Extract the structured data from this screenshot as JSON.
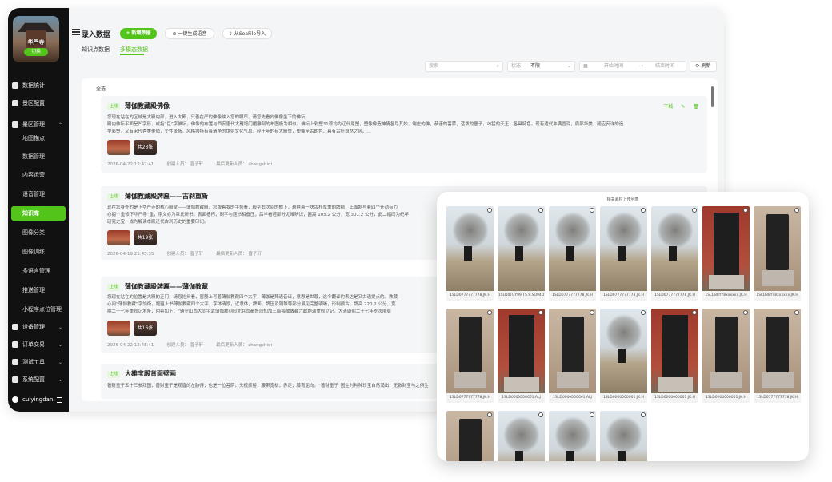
{
  "sidebar": {
    "profile": {
      "name": "华严寺",
      "switch_label": "切换"
    },
    "items": [
      {
        "label": "数据统计",
        "icon": "chart-icon"
      },
      {
        "label": "景区配置",
        "icon": "grid-icon"
      },
      {
        "label": "景区管理",
        "icon": "building-icon",
        "expanded": true
      },
      {
        "label": "设备管理",
        "icon": "device-icon"
      },
      {
        "label": "订单交易",
        "icon": "order-icon"
      },
      {
        "label": "测试工具",
        "icon": "tool-icon"
      },
      {
        "label": "系统配置",
        "icon": "settings-icon"
      }
    ],
    "subitems": [
      "地图描点",
      "数据管理",
      "内容运营",
      "语音管理",
      "知识库",
      "图像分类",
      "图像训练",
      "多语言管理",
      "推送管理",
      "小程序点位管理"
    ],
    "active_subitem": "知识库",
    "user": "cuiyingdan"
  },
  "header": {
    "title": "录入数据",
    "new_button": "+ 新增数据",
    "voice_button": "一键生成语音",
    "import_button": "从SeaFile导入"
  },
  "tabs": [
    "知识点数据",
    "多模态数据"
  ],
  "active_tab": "多模态数据",
  "filters": {
    "search_placeholder": "搜索",
    "status_label": "状态：",
    "status_value": "不限",
    "start_placeholder": "开始时间",
    "end_placeholder": "结束时间",
    "refresh": "刷新"
  },
  "list": {
    "filter_label": "全选",
    "cards": [
      {
        "badge": "上线",
        "title": "薄伽教藏殿佛像",
        "desc": [
          "您现在站在的区域是大殿内部，进入大殿，只善在严的佛像映入您的眼帘，请您先看向佛像坐下的佛坛。",
          "殿内佛坛平面呈凹字形，或指“巨”字佛坛。佛像的布置与西安唐代大雁塔门楣雕刻的布图极为相似。佛坛上彩塑31尊均为辽代原塑，塑像像造神情各尽其妙，端庄的佛，恭谨的菩萨，活泼的童子，凶猛的天王，各具特色。现有遗代丰满圆润，肩部华美，随应安详的造",
          "型彩塑，又有宋代秀美俊俏，个性张扬，风格独特有着清净的世俗文化气息，经千年的有大殿重，塑像至古朗色，具有古朴自然之风。..."
        ],
        "images": 23,
        "count_label": "共23张",
        "date": "2026-04-22 12:47:41",
        "creator": "创建人员：  曾子轩",
        "updater": "最后更新人员：  zhangshiqi",
        "action": "下线"
      },
      {
        "badge": "上线",
        "title": "薄伽教藏殿牌匾——古刹重新",
        "desc": [
          "现在您身处的是下华严寺的核心殿堂——薄伽教藏殿，您跟着我的手势看，殿字右次间的檐下，悬挂着一块古朴厚重的牌额，上面题写着四个苍劲有力",
          "心阁”“重修下华严寺”重，序文亦为章氏所书，表面槽朽，刻字与题书相叠压，后半看若部分尤难辨识，匾高 105.2 公分，宽 301.2 公分，此二幅同为纪年",
          "研究之宝，成为解读本殿辽代古刹历史的重要印记。"
        ],
        "images": 19,
        "count_label": "共19张",
        "date": "2026-04-19 21:45:35",
        "creator": "创建人员：  曾子轩",
        "updater": "最后更新人员：  曾子轩",
        "action": ""
      },
      {
        "badge": "上线",
        "title": "薄伽教藏殿牌匾——薄伽教藏",
        "desc": [
          "您现在站在的位置是大殿的正门，请您抬头看，窗额上写着薄伽教藏四个大字，薄伽是梵语音译，意思是世尊，这个翻译的表达是又古语提点的。教藏",
          "心间“薄伽教藏”字领衔，题匾上书薄伽教藏四个大字，字体清厚，近隶体，牌面，牌压及阴等等部分虽见完整明晰，形制颇古，牌高 220.2 公分，宽",
          "期二十七年重修记木条，内容如下：“辆守山西大同宇武薄伽教刻印北兵营都督同知加三级梅敬敬藏六截题满重修立记。大清康熙二十七年岁次庚辰"
        ],
        "images": 16,
        "count_label": "共16张",
        "date": "2026-04-22 12:48:41",
        "creator": "创建人员：  曾子轩",
        "updater": "最后更新人员：  zhangshiqi",
        "action": ""
      },
      {
        "badge": "上线",
        "title": "大雄宝殿背面壁画",
        "desc": [
          "善财童子五十三参拜图，善财童子是观音的左胁侍，也是一位菩萨，头梳抓髻，腰带宽松，赤足，膝弯屈向。“善财童子”因生时种种珍宝自然涌出，无数财宝与之俱生"
        ],
        "images": 0,
        "count_label": "",
        "date": "",
        "creator": "",
        "updater": "",
        "action": ""
      }
    ]
  },
  "overlay": {
    "title": "相关素材上传列表",
    "photos": [
      {
        "type": "tree",
        "caption": "1SLD0777777778.JK.H"
      },
      {
        "type": "tree",
        "caption": "1SLD0TUY99.TS.9.SO94D"
      },
      {
        "type": "tree",
        "caption": "1SLD0777777778.JK.H"
      },
      {
        "type": "tree",
        "caption": "1SLD0777777778.JK.H"
      },
      {
        "type": "tree",
        "caption": "1SLD0777777778.JK.H"
      },
      {
        "type": "redwall",
        "caption": "1SLD88YY8xxxxxx.JK.H"
      },
      {
        "type": "stele",
        "caption": "1SLD88YY8xxxxxx.JK.H"
      },
      {
        "type": "stele",
        "caption": "1SLD0777777778.JK.H"
      },
      {
        "type": "redwall",
        "caption": "1SLD0000000001.ALJ"
      },
      {
        "type": "stele",
        "caption": "1SLD0000000001.ALJ"
      },
      {
        "type": "tree",
        "caption": "1SLD0000000001.JK.H"
      },
      {
        "type": "redwall",
        "caption": "1SLD0000000001.JK.H"
      },
      {
        "type": "stele",
        "caption": "1SLD0000000001.JK.H"
      },
      {
        "type": "stele",
        "caption": "1SLD0777777778.JK.H"
      },
      {
        "type": "tree",
        "caption": ""
      },
      {
        "type": "tree",
        "caption": ""
      },
      {
        "type": "tree",
        "caption": ""
      }
    ]
  },
  "colors": {
    "accent": "#52c41a",
    "sidebar": "#111111"
  }
}
